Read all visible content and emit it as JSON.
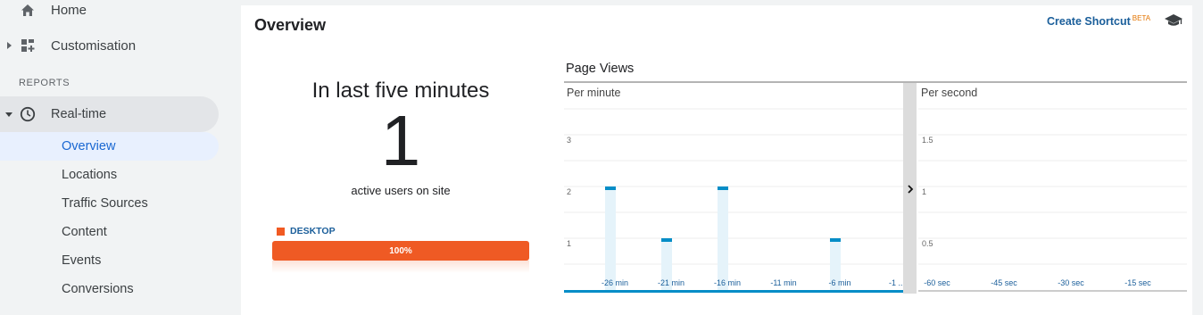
{
  "sidebar": {
    "home_label": "Home",
    "customisation_label": "Customisation",
    "section_label": "REPORTS",
    "realtime_label": "Real-time",
    "sub_items": [
      "Overview",
      "Locations",
      "Traffic Sources",
      "Content",
      "Events",
      "Conversions"
    ],
    "active_sub_item": "Overview"
  },
  "main": {
    "title": "Overview",
    "shortcut_label": "Create Shortcut",
    "shortcut_badge": "BETA",
    "last_five_title": "In last five minutes",
    "active_users": "1",
    "active_users_label": "active users on site",
    "device_label": "DESKTOP",
    "device_percent_label": "100%",
    "device_fraction": 1.0,
    "page_views_title": "Page Views"
  },
  "colors": {
    "accent_blue": "#1a5e9a",
    "desktop_orange": "#ef5a24",
    "bar_blue": "#058dc7",
    "bar_fill": "#e5f3fa"
  },
  "chart_data": [
    {
      "type": "bar",
      "title": "Per minute",
      "ylabel": "",
      "xlabel": "",
      "y_ticks": [
        "1",
        "2",
        "3"
      ],
      "x_tick_labels": [
        "-26 min",
        "-21 min",
        "-16 min",
        "-11 min",
        "-6 min",
        "-1 ..."
      ],
      "x": [
        -30,
        -29,
        -28,
        -27,
        -26,
        -25,
        -24,
        -23,
        -22,
        -21,
        -20,
        -19,
        -18,
        -17,
        -16,
        -15,
        -14,
        -13,
        -12,
        -11,
        -10,
        -9,
        -8,
        -7,
        -6,
        -5,
        -4,
        -3,
        -2,
        -1
      ],
      "values": [
        0,
        0,
        0,
        0,
        2,
        0,
        0,
        0,
        0,
        1,
        0,
        0,
        0,
        0,
        2,
        0,
        0,
        0,
        0,
        0,
        0,
        0,
        0,
        0,
        1,
        0,
        0,
        0,
        0,
        0
      ],
      "ylim": [
        0,
        3.5
      ],
      "grid": true
    },
    {
      "type": "bar",
      "title": "Per second",
      "ylabel": "",
      "xlabel": "",
      "y_ticks": [
        "0.5",
        "1",
        "1.5"
      ],
      "x_tick_labels": [
        "-60 sec",
        "-45 sec",
        "-30 sec",
        "-15 sec"
      ],
      "values": [],
      "ylim": [
        0,
        1.75
      ],
      "grid": true
    }
  ],
  "icons": {
    "home": "home-icon",
    "customisation": "dashboard-plus-icon",
    "realtime": "clock-icon",
    "education": "graduation-cap-icon",
    "collapse_arrow": "chevron-right-icon"
  }
}
